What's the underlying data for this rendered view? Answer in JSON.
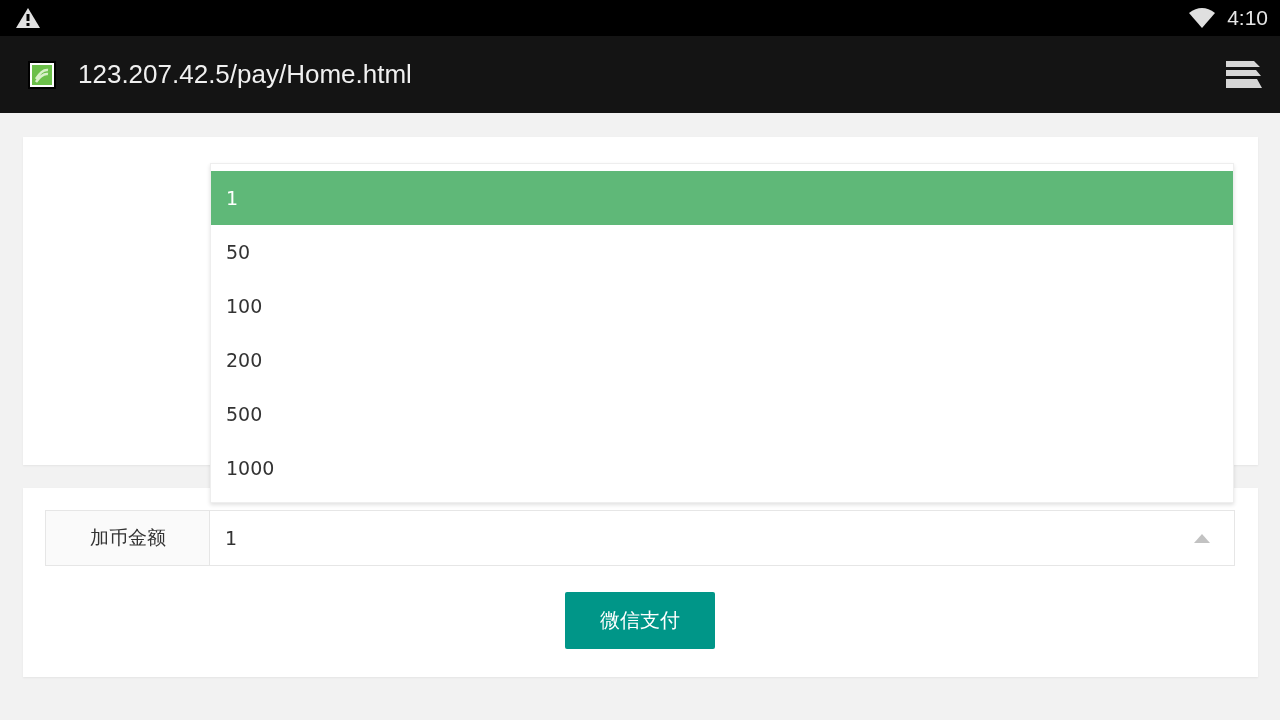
{
  "status_bar": {
    "time": "4:10"
  },
  "browser": {
    "address": "123.207.42.5/pay/Home.html"
  },
  "form": {
    "label": "加币金额",
    "value": "1",
    "expanded": true,
    "options": [
      {
        "label": "1",
        "selected": true
      },
      {
        "label": "50",
        "selected": false
      },
      {
        "label": "100",
        "selected": false
      },
      {
        "label": "200",
        "selected": false
      },
      {
        "label": "500",
        "selected": false
      },
      {
        "label": "1000",
        "selected": false
      }
    ],
    "button": "微信支付"
  }
}
